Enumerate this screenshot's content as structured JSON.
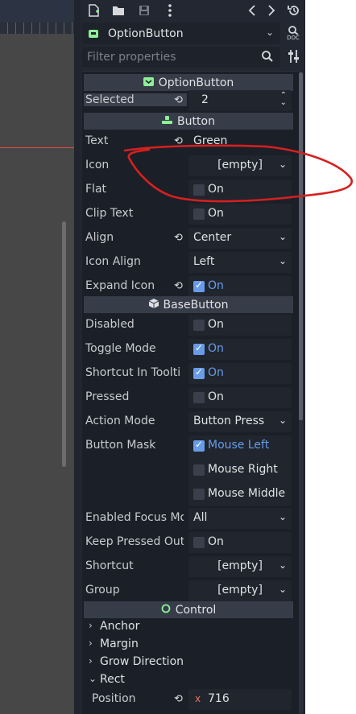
{
  "toolbar": {
    "icons": [
      "new-script-icon",
      "open-icon",
      "save-icon",
      "more-icon",
      "history-back-icon",
      "history-forward-icon",
      "history-icon"
    ]
  },
  "node": {
    "name": "OptionButton"
  },
  "filter": {
    "placeholder": "Filter properties"
  },
  "sections": {
    "option_button": "OptionButton",
    "button": "Button",
    "base_button": "BaseButton",
    "control": "Control"
  },
  "props": {
    "selected": {
      "label": "Selected",
      "value": "2"
    },
    "text": {
      "label": "Text",
      "value": "Green"
    },
    "icon": {
      "label": "Icon",
      "value": "[empty]"
    },
    "flat": {
      "label": "Flat",
      "value": "On"
    },
    "clip_text": {
      "label": "Clip Text",
      "value": "On"
    },
    "align": {
      "label": "Align",
      "value": "Center"
    },
    "icon_align": {
      "label": "Icon Align",
      "value": "Left"
    },
    "expand_icon": {
      "label": "Expand Icon",
      "value": "On"
    },
    "disabled": {
      "label": "Disabled",
      "value": "On"
    },
    "toggle_mode": {
      "label": "Toggle Mode",
      "value": "On"
    },
    "shortcut_in_tooltip": {
      "label": "Shortcut In Toolti",
      "value": "On"
    },
    "pressed": {
      "label": "Pressed",
      "value": "On"
    },
    "action_mode": {
      "label": "Action Mode",
      "value": "Button Press"
    },
    "button_mask": {
      "label": "Button Mask",
      "options": [
        "Mouse Left",
        "Mouse Right",
        "Mouse Middle"
      ]
    },
    "enabled_focus_mode": {
      "label": "Enabled Focus Mo",
      "value": "All"
    },
    "keep_pressed_outside": {
      "label": "Keep Pressed Out",
      "value": "On"
    },
    "shortcut": {
      "label": "Shortcut",
      "value": "[empty]"
    },
    "group": {
      "label": "Group",
      "value": "[empty]"
    }
  },
  "control_groups": [
    "Anchor",
    "Margin",
    "Grow Direction",
    "Rect"
  ],
  "rect": {
    "position_label": "Position",
    "axis": "x",
    "x_value": "716"
  },
  "colors": {
    "panel": "#222731",
    "section": "#363c48",
    "accent": "#699ce8",
    "node_green": "#8eef97",
    "annotation_red": "#d62020"
  }
}
